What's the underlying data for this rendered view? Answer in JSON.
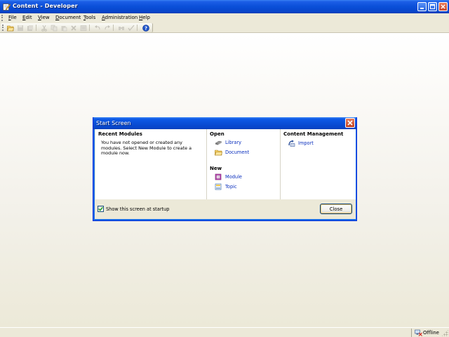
{
  "window": {
    "title": "Content - Developer",
    "icons": {
      "app": "app-pencil-icon",
      "minimize": "minimize-icon",
      "maximize": "maximize-icon",
      "close": "close-icon"
    }
  },
  "menu": {
    "items": [
      {
        "label": "File"
      },
      {
        "label": "Edit"
      },
      {
        "label": "View"
      },
      {
        "label": "Document"
      },
      {
        "label": "Tools"
      },
      {
        "label": "Administration"
      },
      {
        "label": "Help"
      }
    ]
  },
  "toolbar": {
    "buttons": [
      {
        "icon": "open-folder-icon",
        "enabled": true
      },
      {
        "icon": "save-icon",
        "enabled": false
      },
      {
        "icon": "save-as-icon",
        "enabled": false
      },
      {
        "icon": "cut-icon",
        "enabled": false
      },
      {
        "icon": "copy-icon",
        "enabled": false
      },
      {
        "icon": "paste-icon",
        "enabled": false
      },
      {
        "icon": "delete-icon",
        "enabled": false
      },
      {
        "icon": "properties-icon",
        "enabled": false
      },
      {
        "icon": "undo-icon",
        "enabled": false
      },
      {
        "icon": "redo-icon",
        "enabled": false
      },
      {
        "icon": "find-icon",
        "enabled": false
      },
      {
        "icon": "spell-check-icon",
        "enabled": false
      },
      {
        "icon": "help-icon",
        "enabled": true
      }
    ]
  },
  "dialog": {
    "title": "Start Screen",
    "recent": {
      "heading": "Recent Modules",
      "message": "You have not opened or created any modules.  Select New Module to create a module now."
    },
    "open": {
      "heading": "Open",
      "items": [
        {
          "label": "Library",
          "icon": "library-icon"
        },
        {
          "label": "Document",
          "icon": "folder-icon"
        }
      ]
    },
    "new": {
      "heading": "New",
      "items": [
        {
          "label": "Module",
          "icon": "module-icon"
        },
        {
          "label": "Topic",
          "icon": "topic-icon"
        }
      ]
    },
    "content_management": {
      "heading": "Content Management",
      "items": [
        {
          "label": "Import",
          "icon": "import-icon"
        }
      ]
    },
    "show_at_startup": {
      "label": "Show this screen at startup",
      "checked": true
    },
    "close_button": "Close"
  },
  "statusbar": {
    "status": "Offline",
    "icon": "offline-icon"
  },
  "colors": {
    "titlebar": "#0a4fd8",
    "face": "#ece9d8",
    "link": "#0a2fbe"
  }
}
